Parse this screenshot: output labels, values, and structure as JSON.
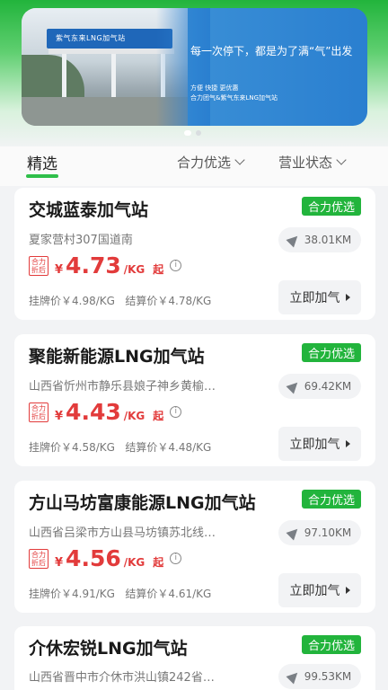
{
  "banner": {
    "canopy_text": "紫气东来LNG加气站",
    "slogan": "每一次停下，都是为了满“气”出发",
    "sub_line1": "方便 快捷 更优惠",
    "sub_line2": "合力团气&紫气东来LNG加气站"
  },
  "tabs": {
    "selected": "精选",
    "filter1": "合力优选",
    "filter2": "营业状态"
  },
  "stations": [
    {
      "name": "交城蓝泰加气站",
      "badge": "合力优选",
      "address": "夏家营村307国道南",
      "distance": "38.01KM",
      "tag": "合力 折后",
      "yen": "¥",
      "price": "4.73",
      "unit": "/KG",
      "qi": "起",
      "list_price": "挂牌价￥4.98/KG",
      "settle_price": "结算价￥4.78/KG",
      "action": "立即加气"
    },
    {
      "name": "聚能新能源LNG加气站",
      "badge": "合力优选",
      "address": "山西省忻州市静乐县娘子神乡黄榆…",
      "distance": "69.42KM",
      "tag": "合力 折后",
      "yen": "¥",
      "price": "4.43",
      "unit": "/KG",
      "qi": "起",
      "list_price": "挂牌价￥4.58/KG",
      "settle_price": "结算价￥4.48/KG",
      "action": "立即加气"
    },
    {
      "name": "方山马坊富康能源LNG加气站",
      "badge": "合力优选",
      "address": "山西省吕梁市方山县马坊镇苏北线…",
      "distance": "97.10KM",
      "tag": "合力 折后",
      "yen": "¥",
      "price": "4.56",
      "unit": "/KG",
      "qi": "起",
      "list_price": "挂牌价￥4.91/KG",
      "settle_price": "结算价￥4.61/KG",
      "action": "立即加气"
    },
    {
      "name": "介休宏锐LNG加气站",
      "badge": "合力优选",
      "address": "山西省晋中市介休市洪山镇242省…",
      "distance": "99.53KM"
    }
  ],
  "colors": {
    "brand_green": "#22b43c",
    "price_red": "#e23b3b",
    "banner_blue": "#2a7fd0"
  },
  "icons": [
    "navigation-arrow-icon",
    "info-icon",
    "chevron-down-icon",
    "play-triangle-icon"
  ]
}
